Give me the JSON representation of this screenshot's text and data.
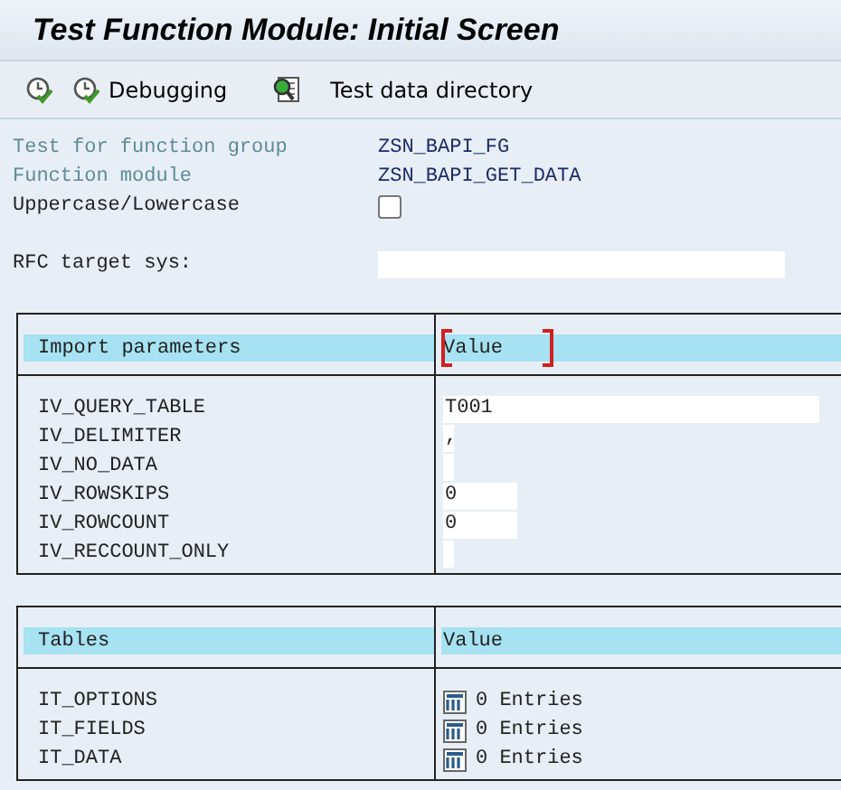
{
  "window": {
    "title": "Test Function Module: Initial Screen"
  },
  "toolbar": [
    {
      "kind": "execute"
    },
    {
      "kind": "debug",
      "label": "Debugging"
    },
    {
      "kind": "testdata",
      "label": "Test data directory"
    }
  ],
  "header_fields": [
    {
      "kind": "display",
      "label": "Test for function group",
      "value": "ZSN_BAPI_FG"
    },
    {
      "kind": "display",
      "label": "Function module",
      "value": "ZSN_BAPI_GET_DATA"
    },
    {
      "kind": "checkbox",
      "label": "Uppercase/Lowercase",
      "checked": false
    }
  ],
  "rfc": {
    "label": "RFC target sys:"
  },
  "import_parameters": {
    "header": "Import parameters",
    "value_header": "Value",
    "focused": true,
    "rows": [
      {
        "name": "IV_QUERY_TABLE",
        "kind": "wide",
        "value": "T001"
      },
      {
        "name": "IV_DELIMITER",
        "kind": "flag",
        "value": ","
      },
      {
        "name": "IV_NO_DATA",
        "kind": "flag"
      },
      {
        "name": "IV_ROWSKIPS",
        "kind": "short",
        "value": "0"
      },
      {
        "name": "IV_ROWCOUNT",
        "kind": "short",
        "value": "0"
      },
      {
        "name": "IV_RECCOUNT_ONLY",
        "kind": "flag"
      }
    ]
  },
  "tables": {
    "header": "Tables",
    "value_header": "Value",
    "focused": false,
    "rows": [
      {
        "name": "IT_OPTIONS",
        "value": "0 Entries"
      },
      {
        "name": "IT_FIELDS",
        "value": "0 Entries"
      },
      {
        "name": "IT_DATA",
        "value": "0 Entries"
      }
    ]
  }
}
